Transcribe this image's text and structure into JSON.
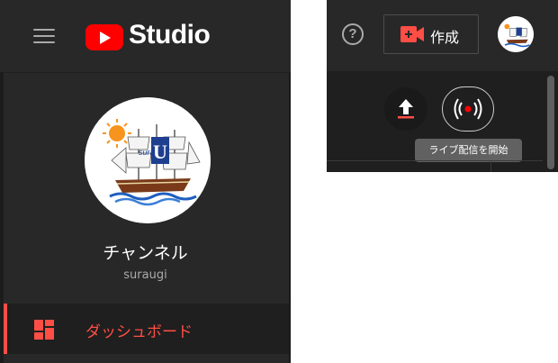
{
  "header": {
    "logo_text": "Studio",
    "create_label": "作成",
    "help_symbol": "?"
  },
  "icons": {
    "menu": "hamburger-menu-icon",
    "help": "help-circle-icon",
    "create": "video-camera-plus-icon",
    "upload": "upload-icon",
    "live": "live-broadcast-icon",
    "dashboard": "dashboard-icon"
  },
  "channel": {
    "title": "チャンネル",
    "handle": "suraugi",
    "avatar_text": "sura"
  },
  "nav": {
    "items": [
      {
        "label": "ダッシュボード",
        "active": true
      }
    ]
  },
  "tooltip": {
    "live": "ライブ配信を開始"
  },
  "colors": {
    "brand_red": "#ff0000",
    "active_accent": "#ff4e45",
    "panel_bg": "#282828",
    "content_bg": "#1f1f1f"
  }
}
